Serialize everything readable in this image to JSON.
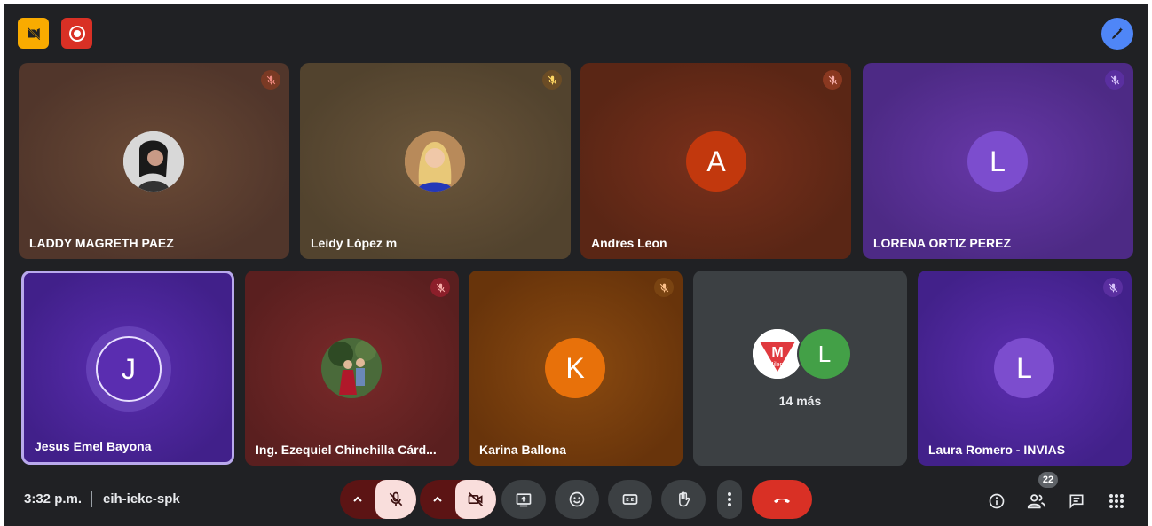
{
  "top_left_badges": [
    {
      "icon": "video-off-badge-icon",
      "color": "#f9ab00"
    },
    {
      "icon": "record-icon",
      "color": "#d93025"
    }
  ],
  "top_right": {
    "icon": "pencil-magic-icon",
    "color": "#4f86f7"
  },
  "participants": [
    {
      "name": "LADDY MAGRETH PAEZ",
      "avatar": "photo",
      "muted": true
    },
    {
      "name": "Leidy López m",
      "avatar": "photo",
      "muted": true
    },
    {
      "name": "Andres Leon",
      "avatar_letter": "A",
      "avatar_color": "#c2380d",
      "muted": true
    },
    {
      "name": "LORENA ORTIZ PEREZ",
      "avatar_letter": "L",
      "avatar_color": "#7c4dce",
      "muted": true
    },
    {
      "name": "Jesus Emel Bayona",
      "avatar_letter": "J",
      "avatar_color": "#5a2db0",
      "speaking": true
    },
    {
      "name": "Ing. Ezequiel Chinchilla Cárd...",
      "avatar": "photo",
      "muted": true
    },
    {
      "name": "Karina Ballona",
      "avatar_letter": "K",
      "avatar_color": "#e8710a",
      "muted": true
    },
    {
      "name": "Laura Romero - INVIAS",
      "avatar_letter": "L",
      "avatar_color": "#7c4dce",
      "muted": true
    }
  ],
  "overflow_tile": {
    "label": "14 más",
    "avatars": [
      {
        "letter": "M",
        "logo_text": "Milena"
      },
      {
        "letter": "L",
        "color": "#43a047"
      }
    ]
  },
  "bottom_bar": {
    "time": "3:32 p.m.",
    "meeting_code": "eih-iekc-spk",
    "controls": [
      "mic-options-caret",
      "mic-off",
      "camera-options-caret",
      "camera-off",
      "present-screen",
      "emoji-reactions",
      "captions",
      "raise-hand",
      "more-options",
      "leave-call"
    ],
    "right_controls": [
      "info",
      "people",
      "chat",
      "activities"
    ],
    "people_count": "22"
  }
}
